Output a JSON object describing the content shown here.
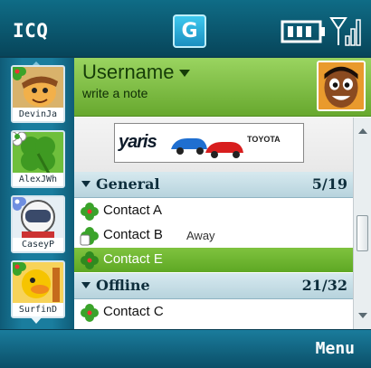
{
  "statusbar": {
    "app_title": "ICQ",
    "g_badge": "G",
    "battery_icon": "battery-icon",
    "signal_icon": "signal-icon"
  },
  "buddy_strip": {
    "items": [
      {
        "label": "DevinJa",
        "icon": "pirate-avatar",
        "badge": "clover-icon"
      },
      {
        "label": "AlexJWh",
        "icon": "clover-avatar",
        "badge": "flower-icon"
      },
      {
        "label": "CaseyP",
        "icon": "astronaut-avatar",
        "badge": "blue-flower-icon"
      },
      {
        "label": "SurfinD",
        "icon": "duck-avatar",
        "badge": "clover-icon"
      }
    ]
  },
  "profile": {
    "username": "Username",
    "note": "write a note",
    "avatar_icon": "cartoon-face-avatar"
  },
  "ad": {
    "brand": "yaris",
    "sponsor": "TOYOTA"
  },
  "groups": [
    {
      "name": "General",
      "count": "5/19",
      "contacts": [
        {
          "name": "Contact A",
          "status": ""
        },
        {
          "name": "Contact B",
          "status": "Away"
        },
        {
          "name": "Contact  E",
          "status": "",
          "selected": true
        }
      ]
    },
    {
      "name": "Offline",
      "count": "21/32",
      "contacts": [
        {
          "name": "Contact C",
          "status": ""
        }
      ]
    }
  ],
  "softkeys": {
    "right": "Menu"
  },
  "colors": {
    "accent_green": "#67a82e",
    "selection_green": "#5ea824",
    "chrome_teal": "#0f6c86"
  }
}
